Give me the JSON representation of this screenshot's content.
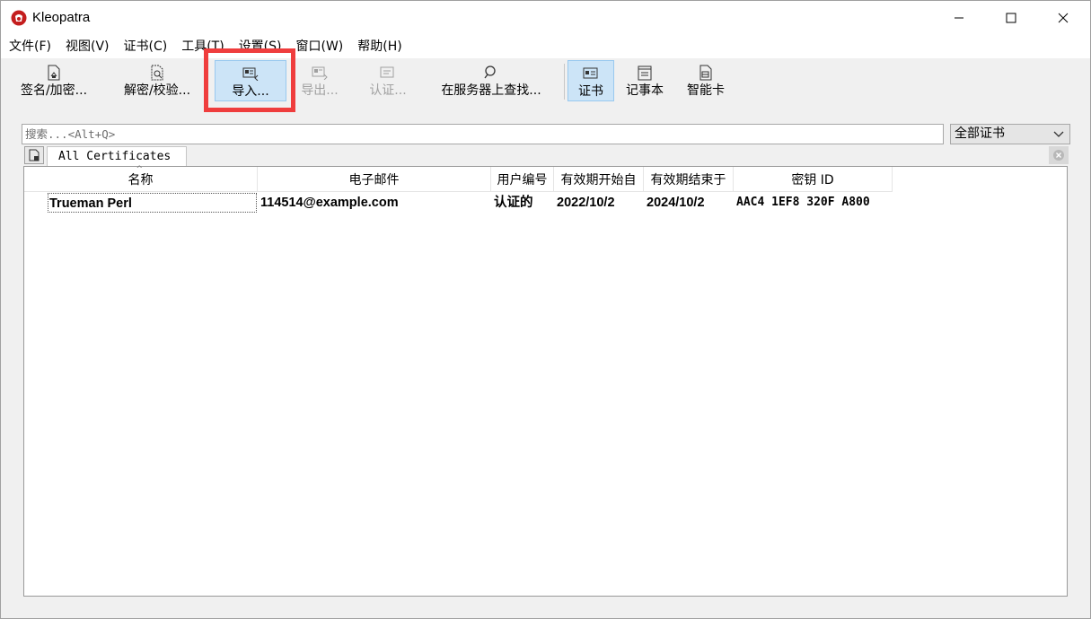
{
  "window": {
    "title": "Kleopatra",
    "controls": {
      "minimize": "minimize-icon",
      "maximize": "maximize-icon",
      "close": "close-icon"
    }
  },
  "menu": [
    "文件(F)",
    "视图(V)",
    "证书(C)",
    "工具(T)",
    "设置(S)",
    "窗口(W)",
    "帮助(H)"
  ],
  "toolbar": {
    "sign_encrypt": "签名/加密...",
    "decrypt_verify": "解密/校验...",
    "import": "导入...",
    "export": "导出...",
    "certify": "认证...",
    "lookup_server": "在服务器上查找...",
    "certificates": "证书",
    "notepad": "记事本",
    "smartcard": "智能卡"
  },
  "search": {
    "placeholder": "搜索...<Alt+Q>"
  },
  "filter": {
    "selected": "全部证书"
  },
  "tabs": [
    {
      "label": "All Certificates",
      "active": true
    }
  ],
  "table": {
    "columns": [
      "名称",
      "电子邮件",
      "用户编号",
      "有效期开始自",
      "有效期结束于",
      "密钥 ID"
    ],
    "sorted_column": "名称",
    "rows": [
      {
        "name": "Trueman Perl",
        "email": "114514@example.com",
        "user_id": "认证的",
        "valid_from": "2022/10/2",
        "valid_until": "2024/10/2",
        "key_id": "AAC4 1EF8 320F A800"
      }
    ]
  },
  "highlight": {
    "target": "import-button",
    "color": "#ef3d3d"
  },
  "colors": {
    "active_toolbar": "#cce4f7",
    "app_icon": "#c41e1e"
  }
}
